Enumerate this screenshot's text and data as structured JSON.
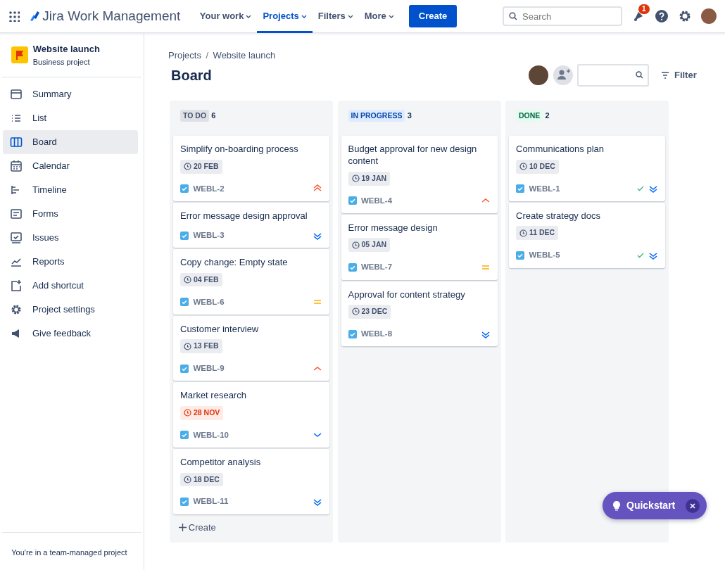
{
  "top_nav": {
    "product": "Jira Work Management",
    "items": [
      {
        "label": "Your work",
        "selected": false
      },
      {
        "label": "Projects",
        "selected": true
      },
      {
        "label": "Filters",
        "selected": false
      },
      {
        "label": "More",
        "selected": false
      }
    ],
    "create_button": "Create",
    "search": {
      "placeholder": "Search"
    },
    "notification_count": "1"
  },
  "sidebar": {
    "project": {
      "name": "Website launch",
      "type": "Business project"
    },
    "items": [
      {
        "label": "Summary",
        "kind": "summary",
        "selected": false
      },
      {
        "label": "List",
        "kind": "list",
        "selected": false
      },
      {
        "label": "Board",
        "kind": "board",
        "selected": true
      },
      {
        "label": "Calendar",
        "kind": "calendar",
        "selected": false
      },
      {
        "label": "Timeline",
        "kind": "timeline",
        "selected": false
      },
      {
        "label": "Forms",
        "kind": "forms",
        "selected": false
      },
      {
        "label": "Issues",
        "kind": "issues",
        "selected": false
      },
      {
        "label": "Reports",
        "kind": "reports",
        "selected": false
      },
      {
        "label": "Add shortcut",
        "kind": "shortcut",
        "selected": false
      },
      {
        "label": "Project settings",
        "kind": "settings",
        "selected": false
      },
      {
        "label": "Give feedback",
        "kind": "feedback",
        "selected": false
      }
    ],
    "footer": "You're in a team-managed project"
  },
  "breadcrumbs": [
    "Projects",
    "Website launch"
  ],
  "breadcrumb_separator": "/",
  "title": "Board",
  "filter_button": "Filter",
  "columns": [
    {
      "name": "TO DO",
      "count": "6",
      "kind": "todo",
      "create_label": "Create",
      "cards": [
        {
          "title": "Simplify on-boarding process",
          "due": "20 FEB",
          "overdue": false,
          "key": "WEBL-2",
          "priority": {
            "kind": "highest"
          },
          "done": false
        },
        {
          "title": "Error message design approval",
          "key": "WEBL-3",
          "priority": {
            "kind": "lowest"
          },
          "done": false
        },
        {
          "title": "Copy change: Empty state",
          "due": "04 FEB",
          "overdue": false,
          "key": "WEBL-6",
          "priority": {
            "kind": "medium"
          },
          "done": false
        },
        {
          "title": "Customer interview",
          "due": "13 FEB",
          "overdue": false,
          "key": "WEBL-9",
          "priority": {
            "kind": "high"
          },
          "done": false
        },
        {
          "title": "Market research",
          "due": "28 NOV",
          "overdue": true,
          "key": "WEBL-10",
          "priority": {
            "kind": "low"
          },
          "done": false
        },
        {
          "title": "Competitor analysis",
          "due": "18 DEC",
          "overdue": false,
          "key": "WEBL-11",
          "priority": {
            "kind": "lowest"
          },
          "done": false
        }
      ]
    },
    {
      "name": "IN PROGRESS",
      "count": "3",
      "kind": "inprogress",
      "cards": [
        {
          "title": "Budget approval for new design content",
          "due": "19 JAN",
          "overdue": false,
          "key": "WEBL-4",
          "priority": {
            "kind": "high"
          },
          "done": false
        },
        {
          "title": "Error message design",
          "due": "05 JAN",
          "overdue": false,
          "key": "WEBL-7",
          "priority": {
            "kind": "medium"
          },
          "done": false
        },
        {
          "title": "Approval for content strategy",
          "due": "23 DEC",
          "overdue": false,
          "key": "WEBL-8",
          "priority": {
            "kind": "lowest"
          },
          "done": false
        }
      ]
    },
    {
      "name": "DONE",
      "count": "2",
      "kind": "done",
      "cards": [
        {
          "title": "Communications plan",
          "due": "10 DEC",
          "overdue": false,
          "key": "WEBL-1",
          "priority": {
            "kind": "lowest"
          },
          "done": true
        },
        {
          "title": "Create strategy docs",
          "due": "11 DEC",
          "overdue": false,
          "key": "WEBL-5",
          "priority": {
            "kind": "lowest"
          },
          "done": true
        }
      ]
    }
  ],
  "quickstart": {
    "label": "Quickstart"
  }
}
